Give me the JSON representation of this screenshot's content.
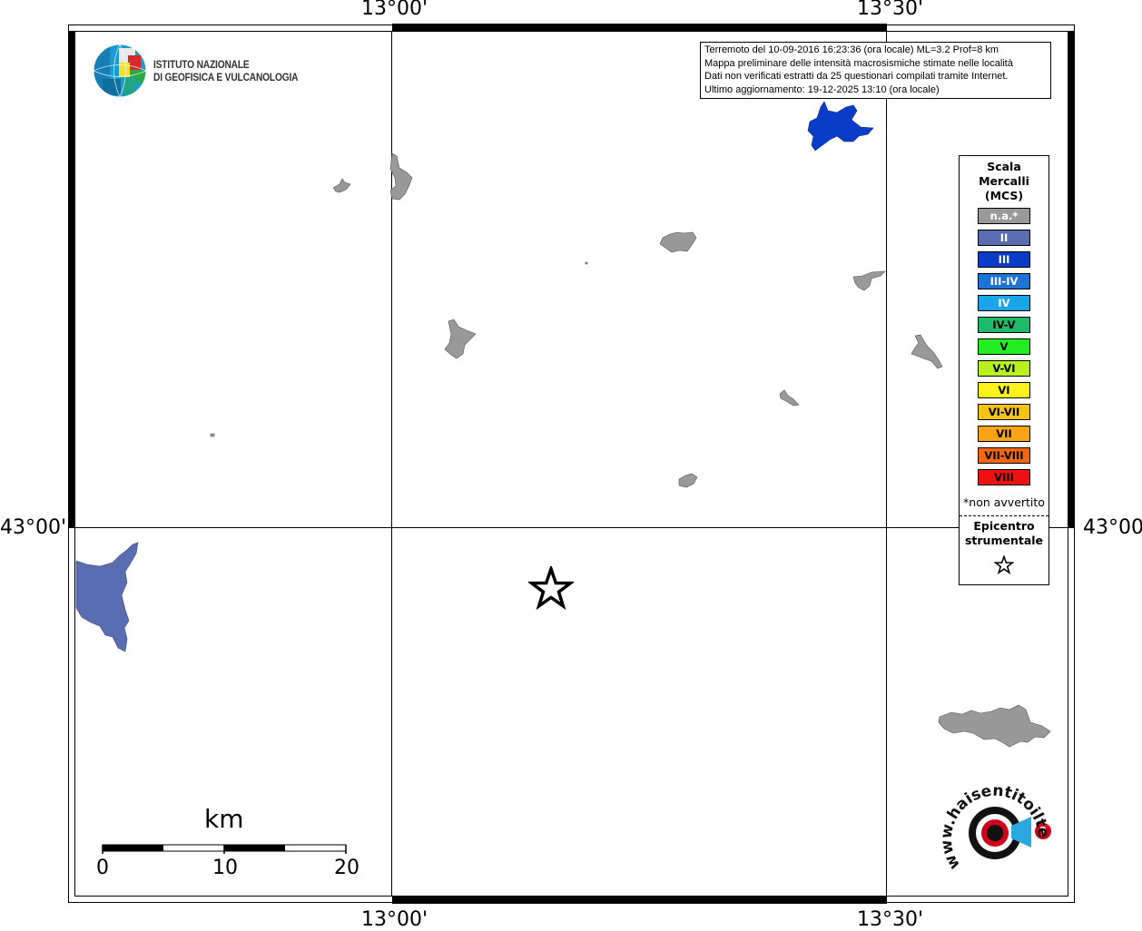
{
  "header": {
    "logo_line1": "ISTITUTO NAZIONALE",
    "logo_line2": "DI GEOFISICA E VULCANOLOGIA"
  },
  "info": {
    "line1": "Terremoto del 10-09-2016 16:23:36 (ora locale) ML=3.2 Prof=8 km",
    "line2": "Mappa preliminare delle intensità macrosismiche stimate nelle località",
    "line3": "Dati non verificati estratti da 25 questionari compilati tramite Internet.",
    "line4": "Ultimo aggiornamento: 19-12-2025 13:10 (ora locale)"
  },
  "axes": {
    "top_left": "13°00'",
    "top_right": "13°30'",
    "bottom_left": "13°00'",
    "bottom_right": "13°30'",
    "left": "43°00'",
    "right": "43°00'"
  },
  "legend": {
    "title1": "Scala",
    "title2": "Mercalli",
    "title3": "(MCS)",
    "items": [
      {
        "label": "n.a.*",
        "color": "#999999",
        "text_color": "#ffffff"
      },
      {
        "label": "II",
        "color": "#5b6db1",
        "text_color": "#ffffff"
      },
      {
        "label": "III",
        "color": "#0a3cc7",
        "text_color": "#ffffff"
      },
      {
        "label": "III-IV",
        "color": "#1f73d6",
        "text_color": "#ffffff"
      },
      {
        "label": "IV",
        "color": "#1aa4ea",
        "text_color": "#ffffff"
      },
      {
        "label": "IV-V",
        "color": "#1fba6a",
        "text_color": "#000000"
      },
      {
        "label": "V",
        "color": "#22ee22",
        "text_color": "#000000"
      },
      {
        "label": "V-VI",
        "color": "#b8f21e",
        "text_color": "#000000"
      },
      {
        "label": "VI",
        "color": "#f9f21b",
        "text_color": "#000000"
      },
      {
        "label": "VI-VII",
        "color": "#f5c316",
        "text_color": "#000000"
      },
      {
        "label": "VII",
        "color": "#f7a514",
        "text_color": "#000000"
      },
      {
        "label": "VII-VIII",
        "color": "#f2660f",
        "text_color": "#000000"
      },
      {
        "label": "VIII",
        "color": "#ee1111",
        "text_color": "#000000"
      }
    ],
    "note": "*non avvertito",
    "epicenter1": "Epicentro",
    "epicenter2": "strumentale"
  },
  "scale": {
    "unit": "km",
    "ticks": [
      "0",
      "10",
      "20"
    ]
  },
  "footer_logo": {
    "text": "www.haisentitoilterremoto.it"
  },
  "colors": {
    "not_felt": "#999999",
    "intensity_II": "#5b6db1",
    "intensity_III": "#0a3cc7"
  }
}
